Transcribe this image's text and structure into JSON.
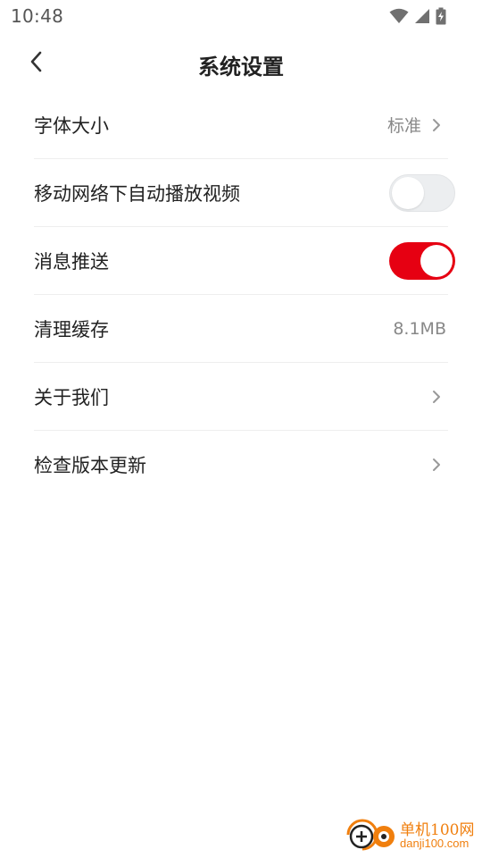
{
  "status_bar": {
    "time": "10:48"
  },
  "header": {
    "title": "系统设置"
  },
  "settings": [
    {
      "label": "字体大小",
      "value": "标准",
      "control": "chevron"
    },
    {
      "label": "移动网络下自动播放视频",
      "control": "toggle",
      "toggle_state": "off"
    },
    {
      "label": "消息推送",
      "control": "toggle",
      "toggle_state": "on"
    },
    {
      "label": "清理缓存",
      "value": "8.1MB",
      "control": "value"
    },
    {
      "label": "关于我们",
      "control": "chevron"
    },
    {
      "label": "检查版本更新",
      "control": "chevron"
    }
  ],
  "colors": {
    "accent": "#e60012",
    "toggle_off": "#eceef0",
    "text_primary": "#222222",
    "text_secondary": "#888888",
    "divider": "#eeeeee",
    "watermark": "#f07f0e"
  },
  "icons": {
    "back": "chevron-left-icon",
    "row_arrow": "chevron-right-icon",
    "status": [
      "wifi-icon",
      "cellular-signal-icon",
      "battery-charging-icon"
    ]
  },
  "watermark": {
    "name": "单机100网",
    "domain": "danji100.com"
  }
}
